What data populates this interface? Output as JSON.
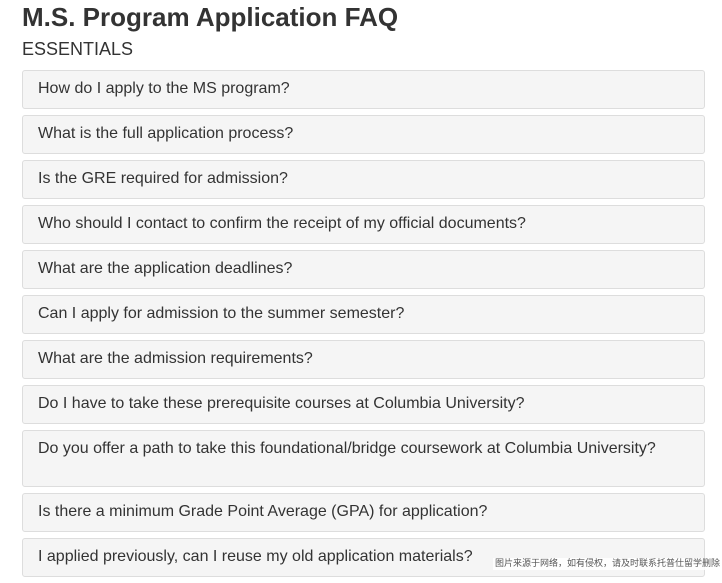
{
  "page": {
    "title": "M.S. Program Application FAQ",
    "section": "ESSENTIALS"
  },
  "faq": {
    "items": [
      {
        "question": "How do I apply to the MS program?"
      },
      {
        "question": "What is the full application process?"
      },
      {
        "question": "Is the GRE required for admission?"
      },
      {
        "question": "Who should I contact to confirm the receipt of my official documents?"
      },
      {
        "question": "What are the application deadlines?"
      },
      {
        "question": "Can I apply for admission to the summer semester?"
      },
      {
        "question": "What are the admission requirements?"
      },
      {
        "question": "Do I have to take these prerequisite courses at Columbia University?"
      },
      {
        "question": "Do you offer a path to take this foundational/bridge coursework at Columbia University?"
      },
      {
        "question": "Is there a minimum Grade Point Average (GPA) for application?"
      },
      {
        "question": "I applied previously, can I reuse my old application materials?"
      }
    ]
  },
  "watermark": {
    "text": "图片来源于网络，如有侵权，请及时联系托普仕留学删除"
  },
  "colors": {
    "text": "#333333",
    "panel_bg": "#f5f5f5",
    "panel_border": "#dddddd"
  }
}
